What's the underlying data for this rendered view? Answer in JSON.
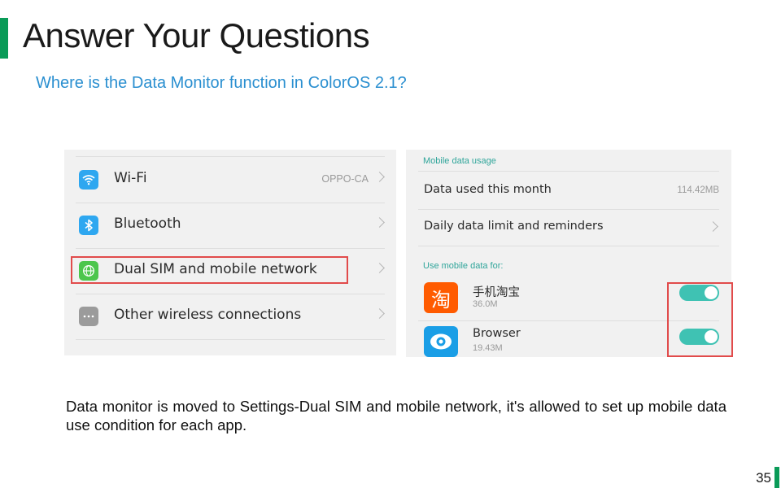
{
  "slide": {
    "title": "Answer Your Questions",
    "subtitle": "Where is the Data Monitor function in ColorOS 2.1?",
    "accent_color": "#0a9b58",
    "subtitle_color": "#2a8fd0",
    "highlight_color": "#e14b4b",
    "body": "Data monitor is moved to Settings-Dual SIM and mobile network, it's allowed to set up mobile data use condition for each app.",
    "page_number": "35"
  },
  "settings_screen": {
    "rows": [
      {
        "label": "Wi-Fi",
        "value": "OPPO-CA",
        "icon": "wifi-icon",
        "icon_color": "#2ea7f0"
      },
      {
        "label": "Bluetooth",
        "value": "",
        "icon": "bluetooth-icon",
        "icon_color": "#2ea7f0"
      },
      {
        "label": "Dual SIM and mobile network",
        "value": "",
        "icon": "globe-icon",
        "icon_color": "#4cc64c"
      },
      {
        "label": "Other wireless connections",
        "value": "",
        "icon": "more-icon",
        "icon_color": "#9b9b9b"
      }
    ]
  },
  "data_screen": {
    "usage_section": "Mobile data usage",
    "usage_rows": [
      {
        "label": "Data used this month",
        "value": "114.42MB"
      },
      {
        "label": "Daily data limit and reminders",
        "value": ""
      }
    ],
    "apps_section": "Use mobile data for:",
    "apps": [
      {
        "name": "手机淘宝",
        "size": "36.0M",
        "icon": "taobao-icon",
        "icon_glyph": "淘",
        "icon_color": "#ff5b00",
        "enabled": true
      },
      {
        "name": "Browser",
        "size": "19.43M",
        "icon": "browser-icon",
        "icon_color": "#1a9ee6",
        "enabled": true
      }
    ],
    "toggle_color": "#3fc2b3"
  }
}
